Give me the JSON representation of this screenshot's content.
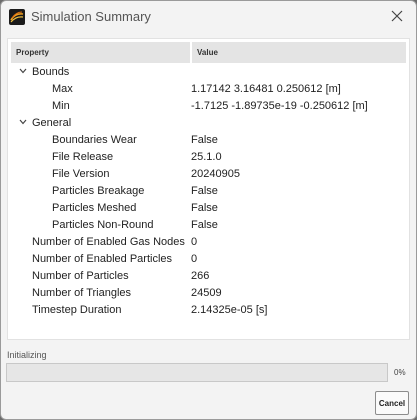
{
  "window": {
    "title": "Simulation Summary",
    "app_icon": "simulation-app-icon",
    "close_icon": "close-icon"
  },
  "table": {
    "columns": [
      "Property",
      "Value"
    ],
    "rows": [
      {
        "label": "Bounds",
        "value": "",
        "level": 0,
        "expandable": true,
        "expanded": true
      },
      {
        "label": "Max",
        "value": "1.17142 3.16481 0.250612 [m]",
        "level": 1
      },
      {
        "label": "Min",
        "value": "-1.7125 -1.89735e-19 -0.250612 [m]",
        "level": 1
      },
      {
        "label": "General",
        "value": "",
        "level": 0,
        "expandable": true,
        "expanded": true
      },
      {
        "label": "Boundaries Wear",
        "value": "False",
        "level": 1
      },
      {
        "label": "File Release",
        "value": "25.1.0",
        "level": 1
      },
      {
        "label": "File Version",
        "value": "20240905",
        "level": 1
      },
      {
        "label": "Particles Breakage",
        "value": "False",
        "level": 1
      },
      {
        "label": "Particles Meshed",
        "value": "False",
        "level": 1
      },
      {
        "label": "Particles Non-Round",
        "value": "False",
        "level": 1
      },
      {
        "label": "Number of Enabled Gas Nodes",
        "value": "0",
        "level": 0
      },
      {
        "label": "Number of Enabled Particles",
        "value": "0",
        "level": 0
      },
      {
        "label": "Number of Particles",
        "value": "266",
        "level": 0
      },
      {
        "label": "Number of Triangles",
        "value": "24509",
        "level": 0
      },
      {
        "label": "Timestep Duration",
        "value": "2.14325e-05 [s]",
        "level": 0
      }
    ]
  },
  "status": {
    "label": "Initializing",
    "progress_percent": 0,
    "progress_text": "0%"
  },
  "buttons": {
    "cancel_label": "Cancel"
  },
  "colors": {
    "progress_fill": "#3a7bd5",
    "header_bg": "#e4e4e4"
  }
}
